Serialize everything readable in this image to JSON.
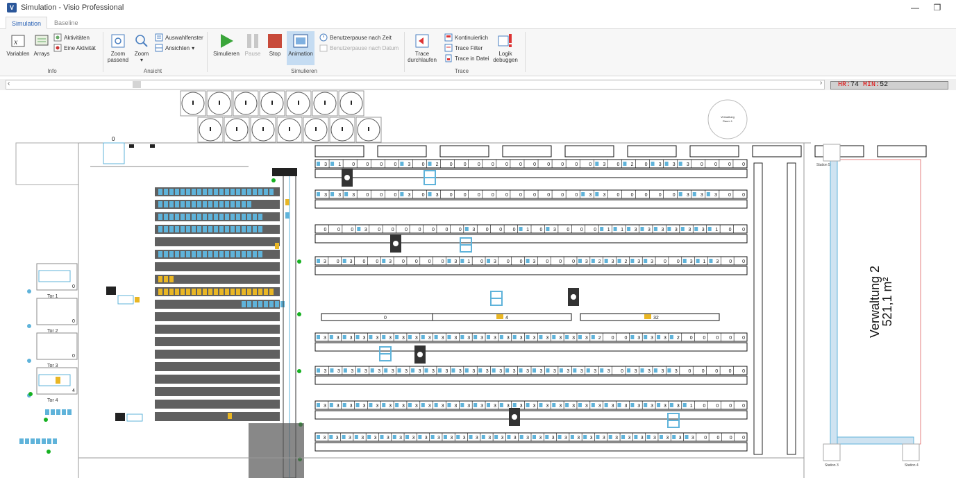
{
  "window": {
    "title": "Simulation - Visio Professional",
    "app_icon": "visio-icon"
  },
  "tabs": [
    {
      "label": "Simulation",
      "active": true
    },
    {
      "label": "Baseline",
      "active": false
    }
  ],
  "ribbon": {
    "groups": {
      "info": "Info",
      "view": "Ansicht",
      "simulate": "Simulieren",
      "trace": "Trace"
    },
    "info": {
      "variables": "Variablen",
      "arrays": "Arrays",
      "activities": "Aktivitäten",
      "one_activity": "Eine Aktivität"
    },
    "view": {
      "zoom_fit_1": "Zoom",
      "zoom_fit_2": "passend",
      "zoom": "Zoom",
      "selection_window": "Auswahlfenster",
      "views": "Ansichten"
    },
    "simulate": {
      "run": "Simulieren",
      "pause": "Pause",
      "stop": "Stop",
      "animation": "Animation",
      "pause_time": "Benutzerpause nach Zeit",
      "pause_date": "Benutzerpause nach Datum"
    },
    "trace": {
      "step_1": "Trace",
      "step_2": "durchlaufen",
      "continuous": "Kontinuierlich",
      "filter": "Trace Filter",
      "to_file": "Trace in Datei",
      "debug_1": "Logik",
      "debug_2": "debuggen"
    }
  },
  "status": {
    "hr_label": "HR:",
    "hr_value": "74",
    "min_label": "MIN:",
    "min_value": "52"
  },
  "layout": {
    "admin_area_name": "Verwaltung 2",
    "admin_area_size": "521,1 m²",
    "stations": [
      "Station 5",
      "Station 3",
      "Station 4"
    ],
    "gates": [
      "Tor 1",
      "Tor 2",
      "Tor 3",
      "Tor 4"
    ],
    "counts": {
      "top": "0",
      "gate1": "0",
      "gate2": "0",
      "gate3": "0",
      "gate4": "4",
      "mid_a": "0",
      "mid_b": "4",
      "mid_c": "32"
    },
    "round_label": "Verwaltung\nRaum 1",
    "rack_rows": [
      [
        "3",
        "1",
        "0",
        "0",
        "0",
        "0",
        "3",
        "0",
        "2",
        "0",
        "0",
        "0",
        "0",
        "0",
        "0",
        "0",
        "0",
        "0",
        "0",
        "0",
        "3",
        "0",
        "2",
        "0",
        "3",
        "3",
        "3",
        "0",
        "0",
        "0",
        "0"
      ],
      [
        "3",
        "3",
        "3",
        "0",
        "0",
        "0",
        "3",
        "0",
        "3",
        "0",
        "0",
        "0",
        "0",
        "0",
        "0",
        "0",
        "0",
        "0",
        "0",
        "3",
        "3",
        "0",
        "0",
        "0",
        "0",
        "0",
        "3",
        "3",
        "3",
        "0",
        "0"
      ],
      [
        "0",
        "0",
        "0",
        "3",
        "0",
        "0",
        "0",
        "0",
        "0",
        "0",
        "0",
        "3",
        "0",
        "0",
        "0",
        "1",
        "0",
        "3",
        "0",
        "0",
        "0",
        "1",
        "1",
        "3",
        "3",
        "3",
        "3",
        "3",
        "3",
        "1",
        "0",
        "0"
      ],
      [
        "3",
        "0",
        "3",
        "0",
        "0",
        "3",
        "0",
        "0",
        "0",
        "0",
        "3",
        "1",
        "0",
        "3",
        "0",
        "0",
        "3",
        "0",
        "0",
        "0",
        "3",
        "2",
        "3",
        "2",
        "3",
        "3",
        "0",
        "0",
        "3",
        "1",
        "3",
        "0",
        "0"
      ],
      [
        "3",
        "3",
        "3",
        "3",
        "3",
        "3",
        "3",
        "3",
        "3",
        "3",
        "3",
        "3",
        "3",
        "3",
        "3",
        "3",
        "3",
        "3",
        "3",
        "3",
        "3",
        "2",
        "0",
        "0",
        "3",
        "3",
        "3",
        "2",
        "0",
        "0",
        "0",
        "0",
        "0"
      ],
      [
        "3",
        "3",
        "3",
        "3",
        "3",
        "3",
        "3",
        "3",
        "3",
        "3",
        "3",
        "3",
        "3",
        "3",
        "3",
        "3",
        "3",
        "3",
        "3",
        "3",
        "3",
        "3",
        "0",
        "3",
        "3",
        "3",
        "3",
        "0",
        "0",
        "0",
        "0",
        "0"
      ],
      [
        "3",
        "3",
        "3",
        "3",
        "3",
        "3",
        "3",
        "3",
        "3",
        "3",
        "3",
        "3",
        "3",
        "3",
        "3",
        "3",
        "3",
        "3",
        "3",
        "3",
        "3",
        "3",
        "3",
        "3",
        "3",
        "3",
        "3",
        "3",
        "1",
        "0",
        "0",
        "0",
        "0"
      ],
      [
        "3",
        "3",
        "3",
        "3",
        "3",
        "3",
        "3",
        "3",
        "3",
        "3",
        "3",
        "3",
        "3",
        "3",
        "3",
        "3",
        "3",
        "3",
        "3",
        "3",
        "3",
        "3",
        "3",
        "3",
        "3",
        "3",
        "3",
        "3",
        "3",
        "3",
        "0",
        "0",
        "0",
        "0"
      ]
    ],
    "colors": {
      "blue_box": "#5fb3da",
      "yellow_box": "#e9b624",
      "green_dot": "#16b121",
      "line": "#111111"
    }
  }
}
